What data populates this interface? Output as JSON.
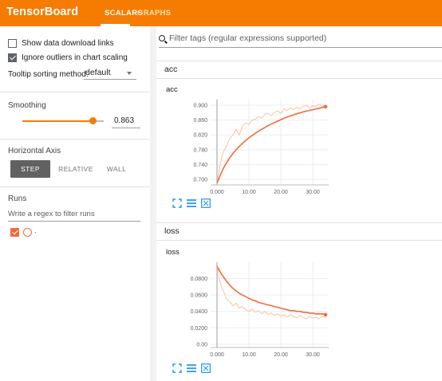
{
  "header": {
    "brand": "TensorBoard",
    "tabs": [
      {
        "label": "SCALARS",
        "active": true
      },
      {
        "label": "GRAPHS",
        "active": false
      }
    ],
    "color": "#f57c00"
  },
  "sidebar": {
    "options": [
      {
        "label": "Show data download links",
        "checked": false
      },
      {
        "label": "Ignore outliers in chart scaling",
        "checked": true
      }
    ],
    "tooltip_sorting": {
      "label": "Tooltip sorting method:",
      "value": "default"
    },
    "smoothing": {
      "title": "Smoothing",
      "value": "0.863",
      "fraction": 0.863
    },
    "horizontal_axis": {
      "title": "Horizontal Axis",
      "options": [
        "STEP",
        "RELATIVE",
        "WALL"
      ],
      "selected": "STEP"
    },
    "runs": {
      "title": "Runs",
      "filter_placeholder": "Write a regex to filter runs",
      "items": [
        {
          "name": ".",
          "checked": true,
          "color": "#f26b3a"
        }
      ]
    }
  },
  "main": {
    "search_placeholder": "Filter tags (regular expressions supported)",
    "groups": [
      {
        "title": "acc",
        "card_title": "acc"
      },
      {
        "title": "loss",
        "card_title": "loss"
      }
    ]
  },
  "chart_data": [
    {
      "type": "line",
      "title": "acc",
      "xlabel": "",
      "ylabel": "",
      "xlim": [
        -2,
        35
      ],
      "ylim": [
        0.685,
        0.915
      ],
      "x_ticks": [
        "0.000",
        "10.00",
        "20.00",
        "30.00"
      ],
      "y_ticks": [
        "0.900",
        "0.860",
        "0.820",
        "0.780",
        "0.740",
        "0.700"
      ],
      "x_tick_values": [
        0,
        10,
        20,
        30
      ],
      "y_tick_values": [
        0.9,
        0.86,
        0.82,
        0.78,
        0.74,
        0.7
      ],
      "series": [
        {
          "role": "raw",
          "color": "#fbc1a6",
          "x": [
            0,
            1,
            2,
            3,
            4,
            5,
            6,
            7,
            8,
            9,
            10,
            11,
            12,
            13,
            14,
            15,
            16,
            17,
            18,
            19,
            20,
            21,
            22,
            23,
            24,
            25,
            26,
            27,
            28,
            29,
            30,
            31,
            32,
            33,
            34
          ],
          "y": [
            0.69,
            0.742,
            0.775,
            0.79,
            0.81,
            0.82,
            0.835,
            0.82,
            0.845,
            0.852,
            0.848,
            0.86,
            0.862,
            0.87,
            0.865,
            0.875,
            0.878,
            0.872,
            0.88,
            0.885,
            0.878,
            0.89,
            0.885,
            0.893,
            0.888,
            0.895,
            0.89,
            0.897,
            0.9,
            0.892,
            0.898,
            0.897,
            0.903,
            0.897,
            0.9
          ]
        },
        {
          "role": "smoothed",
          "color": "#f26b3a",
          "x": [
            0,
            1,
            2,
            3,
            4,
            5,
            6,
            7,
            8,
            9,
            10,
            11,
            12,
            13,
            14,
            15,
            16,
            17,
            18,
            19,
            20,
            21,
            22,
            23,
            24,
            25,
            26,
            27,
            28,
            29,
            30,
            31,
            32,
            33,
            34
          ],
          "y": [
            0.69,
            0.711,
            0.73,
            0.745,
            0.758,
            0.77,
            0.78,
            0.789,
            0.797,
            0.805,
            0.812,
            0.818,
            0.824,
            0.83,
            0.835,
            0.84,
            0.845,
            0.849,
            0.853,
            0.857,
            0.861,
            0.865,
            0.868,
            0.871,
            0.874,
            0.877,
            0.879,
            0.882,
            0.884,
            0.886,
            0.888,
            0.89,
            0.892,
            0.894,
            0.896
          ]
        }
      ]
    },
    {
      "type": "line",
      "title": "loss",
      "xlabel": "",
      "ylabel": "",
      "xlim": [
        -2,
        35
      ],
      "ylim": [
        -0.004,
        0.1
      ],
      "x_ticks": [
        "0.000",
        "10.00",
        "20.00",
        "30.00"
      ],
      "y_ticks": [
        "0.0800",
        "0.0600",
        "0.0400",
        "0.0200",
        "0.00"
      ],
      "x_tick_values": [
        0,
        10,
        20,
        30
      ],
      "y_tick_values": [
        0.08,
        0.06,
        0.04,
        0.02,
        0.0
      ],
      "series": [
        {
          "role": "raw",
          "color": "#fbc1a6",
          "x": [
            0,
            1,
            2,
            3,
            4,
            5,
            6,
            7,
            8,
            9,
            10,
            11,
            12,
            13,
            14,
            15,
            16,
            17,
            18,
            19,
            20,
            21,
            22,
            23,
            24,
            25,
            26,
            27,
            28,
            29,
            30,
            31,
            32,
            33,
            34
          ],
          "y": [
            0.095,
            0.075,
            0.065,
            0.055,
            0.052,
            0.047,
            0.05,
            0.044,
            0.046,
            0.042,
            0.04,
            0.043,
            0.039,
            0.041,
            0.037,
            0.04,
            0.036,
            0.038,
            0.035,
            0.037,
            0.034,
            0.036,
            0.033,
            0.036,
            0.034,
            0.032,
            0.035,
            0.033,
            0.031,
            0.034,
            0.032,
            0.033,
            0.031,
            0.034,
            0.032
          ]
        },
        {
          "role": "smoothed",
          "color": "#f26b3a",
          "x": [
            0,
            1,
            2,
            3,
            4,
            5,
            6,
            7,
            8,
            9,
            10,
            11,
            12,
            13,
            14,
            15,
            16,
            17,
            18,
            19,
            20,
            21,
            22,
            23,
            24,
            25,
            26,
            27,
            28,
            29,
            30,
            31,
            32,
            33,
            34
          ],
          "y": [
            0.095,
            0.088,
            0.082,
            0.077,
            0.072,
            0.068,
            0.065,
            0.062,
            0.06,
            0.058,
            0.056,
            0.054,
            0.053,
            0.051,
            0.05,
            0.049,
            0.048,
            0.047,
            0.046,
            0.045,
            0.044,
            0.043,
            0.042,
            0.041,
            0.041,
            0.04,
            0.04,
            0.039,
            0.039,
            0.038,
            0.038,
            0.037,
            0.037,
            0.037,
            0.036
          ]
        }
      ]
    }
  ]
}
